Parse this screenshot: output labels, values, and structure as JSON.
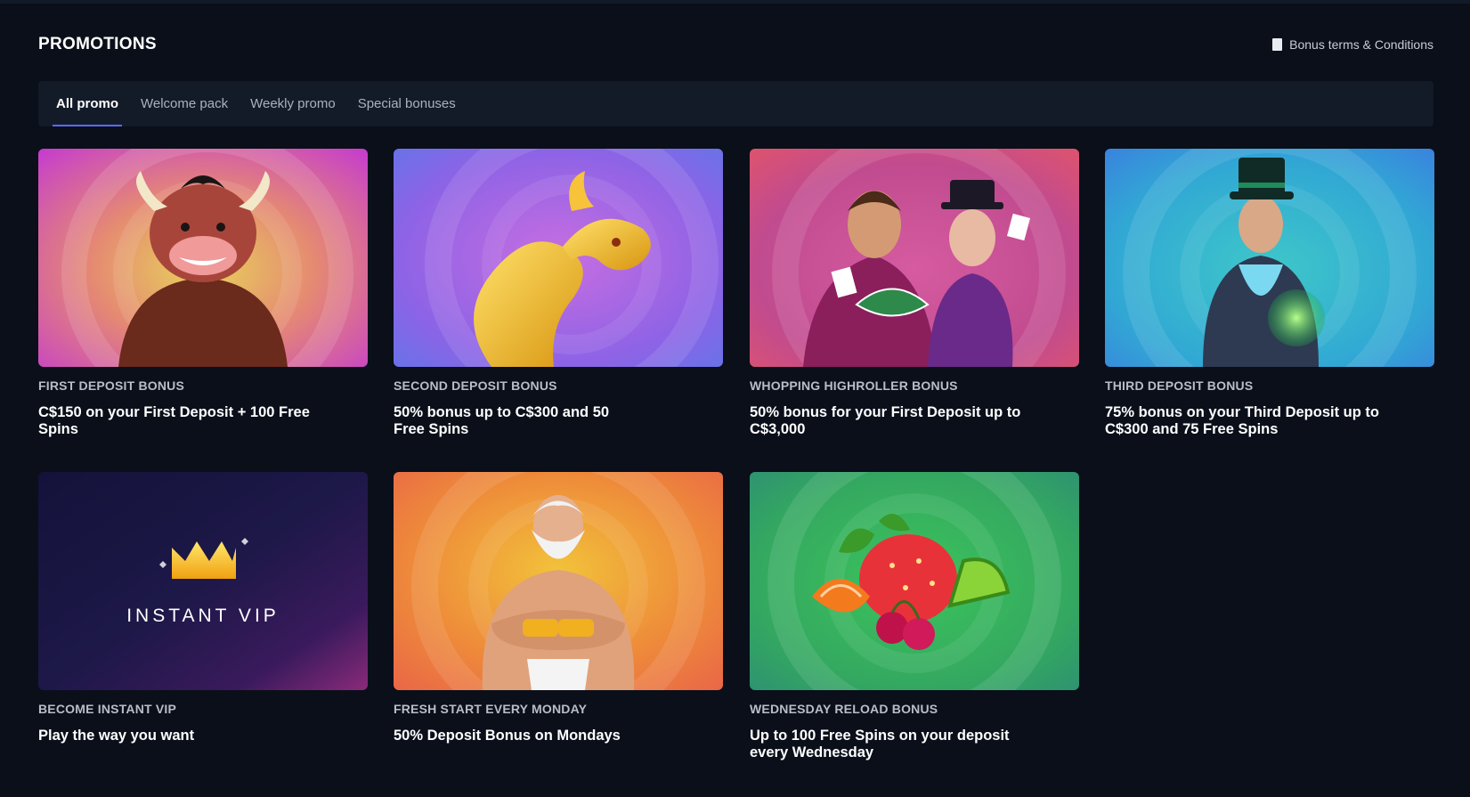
{
  "header": {
    "title": "PROMOTIONS",
    "terms_label": "Bonus terms & Conditions"
  },
  "tabs": [
    {
      "label": "All promo",
      "active": true
    },
    {
      "label": "Welcome pack",
      "active": false
    },
    {
      "label": "Weekly promo",
      "active": false
    },
    {
      "label": "Special bonuses",
      "active": false
    }
  ],
  "promotions": [
    {
      "label": "FIRST DEPOSIT BONUS",
      "title": "C$150 on your First Deposit + 100 Free Spins",
      "image": "bull-character"
    },
    {
      "label": "SECOND DEPOSIT BONUS",
      "title": "50% bonus up to C$300 and 50 Free Spins",
      "image": "golden-dragon"
    },
    {
      "label": "WHOPPING HIGHROLLER BONUS",
      "title": "50% bonus for your First Deposit up to C$3,000",
      "image": "card-magicians"
    },
    {
      "label": "THIRD DEPOSIT BONUS",
      "title": "75% bonus on your Third Deposit up to C$300 and 75 Free Spins",
      "image": "top-hat-magician"
    },
    {
      "label": "BECOME INSTANT VIP",
      "title": "Play the way you want",
      "image": "crown",
      "image_text": "INSTANT VIP"
    },
    {
      "label": "FRESH START EVERY MONDAY",
      "title": "50% Deposit Bonus on Mondays",
      "image": "zeus"
    },
    {
      "label": "WEDNESDAY RELOAD BONUS",
      "title": "Up to 100 Free Spins on your deposit every Wednesday",
      "image": "fruits"
    }
  ],
  "colors": {
    "background": "#0a0f1a",
    "tab_bar": "#131b29",
    "accent": "#5b6bff"
  }
}
